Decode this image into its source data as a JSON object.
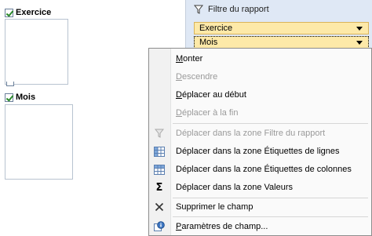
{
  "field_list": {
    "groups": [
      {
        "label": "Exercice",
        "checked": true
      },
      {
        "label": "Mois",
        "checked": true
      }
    ]
  },
  "report_filter": {
    "title": "Filtre du rapport",
    "items": [
      "Exercice",
      "Mois"
    ]
  },
  "context_menu": {
    "items": [
      {
        "label": "Monter",
        "enabled": true,
        "icon": ""
      },
      {
        "label": "Descendre",
        "enabled": false,
        "icon": ""
      },
      {
        "label": "Déplacer au début",
        "enabled": true,
        "icon": ""
      },
      {
        "label": "Déplacer à la fin",
        "enabled": false,
        "icon": ""
      },
      {
        "label": "Déplacer dans la zone Filtre du rapport",
        "enabled": false,
        "icon": "filter-icon"
      },
      {
        "label": "Déplacer dans la zone Étiquettes de lignes",
        "enabled": true,
        "icon": "row-labels-icon"
      },
      {
        "label": "Déplacer dans la zone Étiquettes de colonnes",
        "enabled": true,
        "icon": "column-labels-icon"
      },
      {
        "label": "Déplacer dans la zone Valeurs",
        "enabled": true,
        "icon": "sigma-icon"
      },
      {
        "label": "Supprimer le champ",
        "enabled": true,
        "icon": "delete-x-icon"
      },
      {
        "label": "Paramètres de champ...",
        "enabled": true,
        "icon": "field-settings-icon"
      }
    ]
  },
  "colors": {
    "filter_bg": "#dfe8f5",
    "drop_item": "#fde9a8",
    "disabled_text": "#9a9a9a"
  }
}
